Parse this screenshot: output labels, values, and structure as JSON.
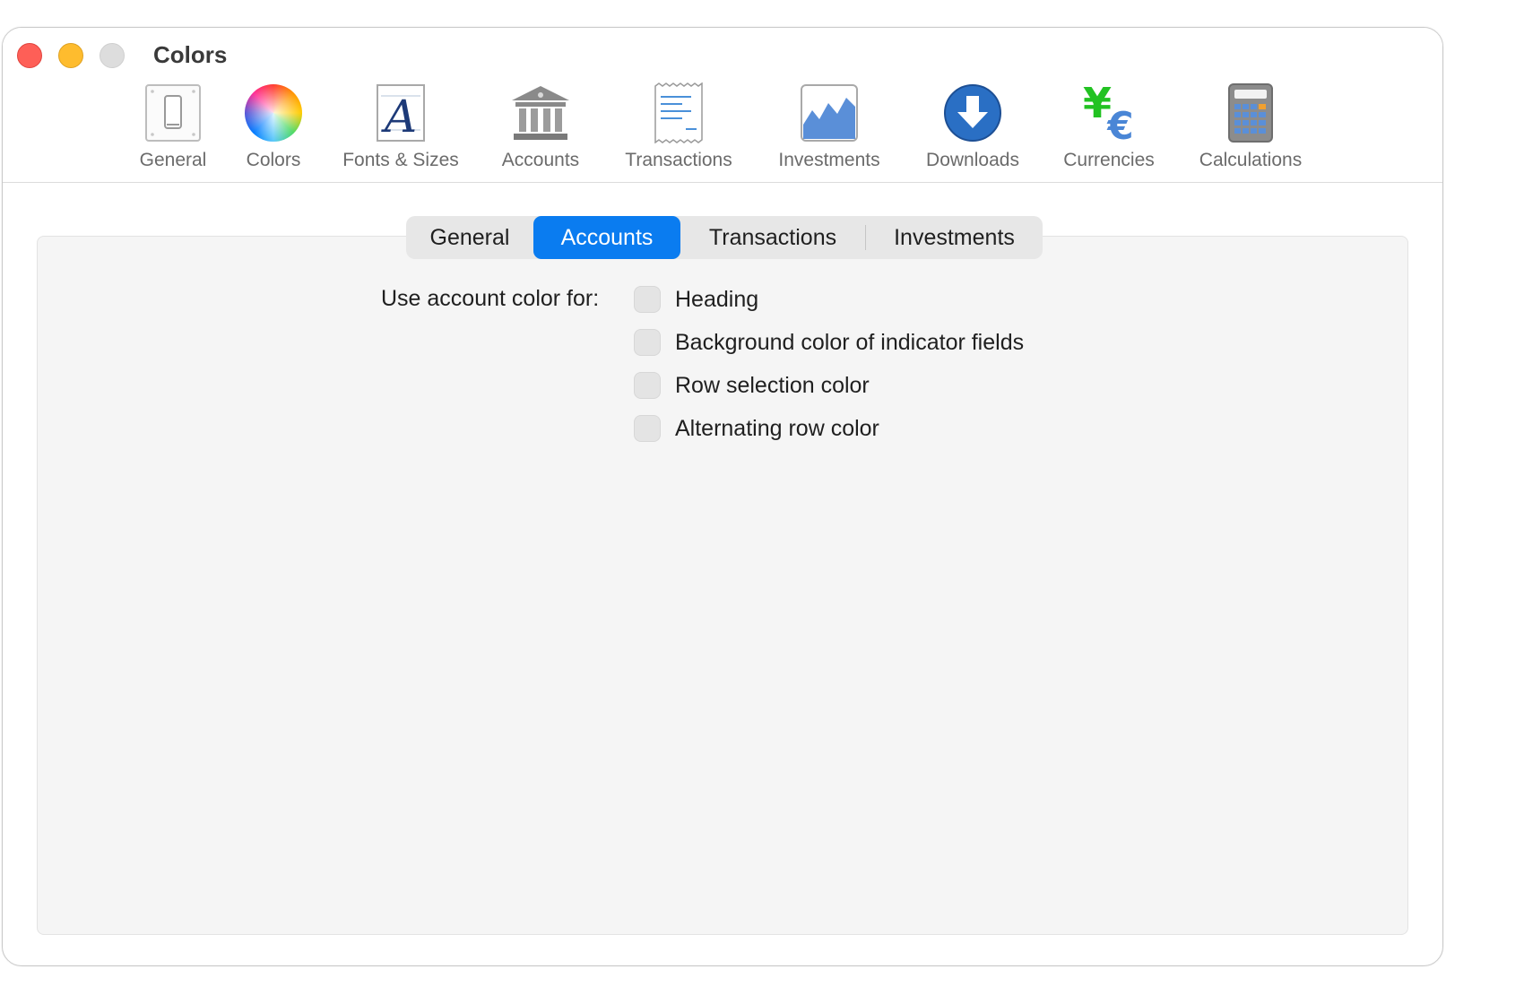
{
  "window": {
    "title": "Colors"
  },
  "toolbar": {
    "items": [
      {
        "label": "General",
        "icon": "general-switch-icon"
      },
      {
        "label": "Colors",
        "icon": "color-wheel-icon"
      },
      {
        "label": "Fonts & Sizes",
        "icon": "font-icon"
      },
      {
        "label": "Accounts",
        "icon": "bank-icon"
      },
      {
        "label": "Transactions",
        "icon": "receipt-icon"
      },
      {
        "label": "Investments",
        "icon": "chart-icon"
      },
      {
        "label": "Downloads",
        "icon": "download-icon"
      },
      {
        "label": "Currencies",
        "icon": "currency-icon"
      },
      {
        "label": "Calculations",
        "icon": "calculator-icon"
      }
    ]
  },
  "tabs": {
    "items": [
      "General",
      "Accounts",
      "Transactions",
      "Investments"
    ],
    "selected": "Accounts"
  },
  "settings": {
    "use_label": "Use account color for:",
    "options": [
      {
        "label": "Heading",
        "checked": false
      },
      {
        "label": "Background color of indicator fields",
        "checked": false
      },
      {
        "label": "Row selection color",
        "checked": false
      },
      {
        "label": "Alternating row color",
        "checked": false
      }
    ]
  },
  "colors": {
    "accent": "#0a7cf0",
    "close": "#fe5f57",
    "minimize": "#febc2e",
    "zoom_disabled": "#dddddd"
  }
}
